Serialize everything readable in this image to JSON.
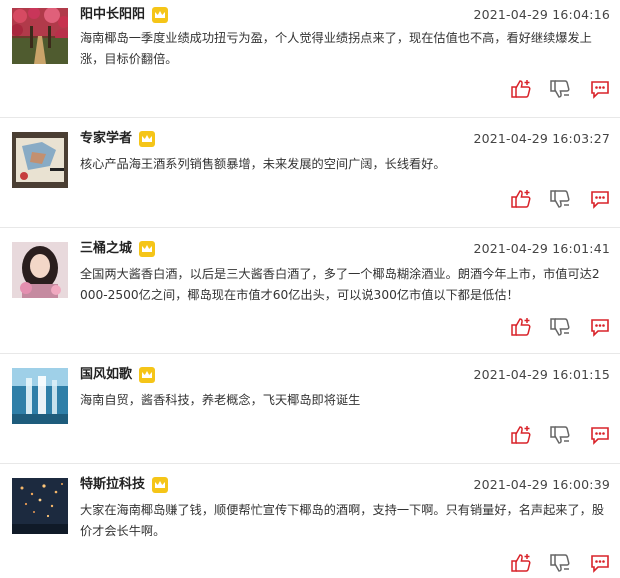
{
  "colors": {
    "accent": "#d9232a",
    "crown": "#f0b400",
    "divider": "#e8e8e8"
  },
  "comments": [
    {
      "username": "阳中长阳阳",
      "time": "2021-04-29 16:04:16",
      "content": "海南椰岛一季度业绩成功扭亏为盈，个人觉得业绩拐点来了，现在估值也不高，看好继续爆发上涨，目标价翻倍。",
      "avatar_icon": "flower-garden-path-avatar"
    },
    {
      "username": "专家学者",
      "time": "2021-04-29 16:03:27",
      "content": "核心产品海王酒系列销售额暴增，未来发展的空间广阔，长线看好。",
      "avatar_icon": "drawing-desk-avatar"
    },
    {
      "username": "三桶之城",
      "time": "2021-04-29 16:01:41",
      "content": "全国两大酱香白酒，以后是三大酱香白酒了，多了一个椰岛糊涂酒业。朗酒今年上市，市值可达2000-2500亿之间，椰岛现在市值才60亿出头，可以说300亿市值以下都是低估！",
      "avatar_icon": "woman-portrait-avatar"
    },
    {
      "username": "国风如歌",
      "time": "2021-04-29 16:01:15",
      "content": "海南自贸，酱香科技，养老概念，飞天椰岛即将诞生",
      "avatar_icon": "waterfall-avatar"
    },
    {
      "username": "特斯拉科技",
      "time": "2021-04-29 16:00:39",
      "content": "大家在海南椰岛赚了钱，顺便帮忙宣传下椰岛的酒啊，支持一下啊。只有销量好，名声起来了，股价才会长牛啊。",
      "avatar_icon": "night-sky-lanterns-avatar"
    }
  ]
}
